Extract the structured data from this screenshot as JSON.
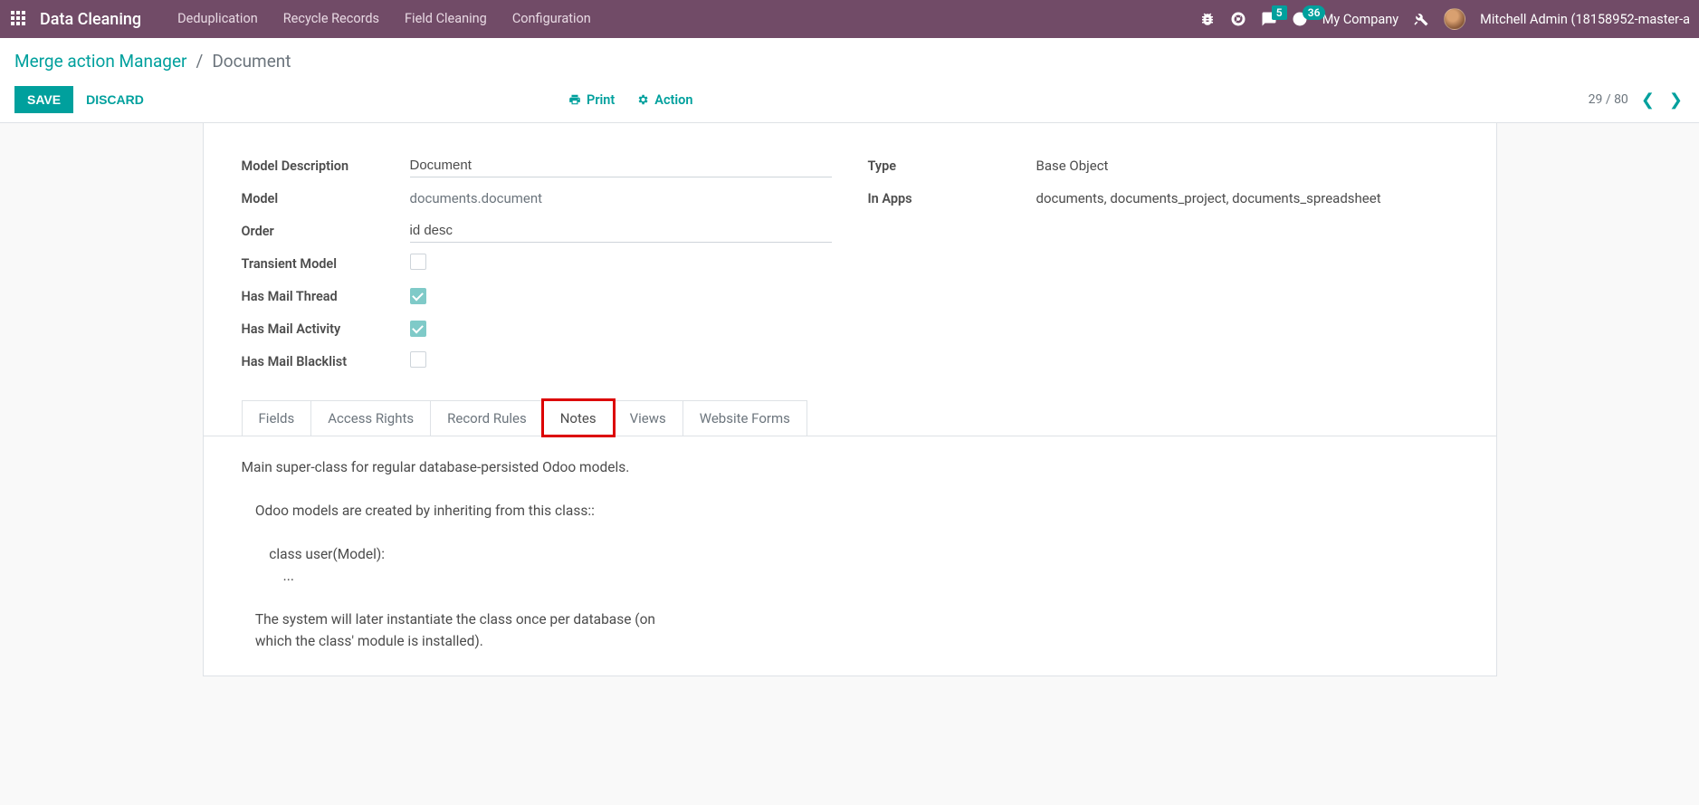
{
  "navbar": {
    "brand": "Data Cleaning",
    "menu": [
      "Deduplication",
      "Recycle Records",
      "Field Cleaning",
      "Configuration"
    ],
    "messages_badge": "5",
    "activities_badge": "36",
    "company": "My Company",
    "user": "Mitchell Admin (18158952-master-a"
  },
  "breadcrumb": {
    "parent": "Merge action Manager",
    "current": "Document"
  },
  "actions": {
    "save": "SAVE",
    "discard": "DISCARD",
    "print": "Print",
    "action": "Action"
  },
  "pager": {
    "text": "29 / 80"
  },
  "form": {
    "left": {
      "model_description_label": "Model Description",
      "model_description_value": "Document",
      "model_label": "Model",
      "model_value": "documents.document",
      "order_label": "Order",
      "order_value": "id desc",
      "transient_label": "Transient Model",
      "mail_thread_label": "Has Mail Thread",
      "mail_activity_label": "Has Mail Activity",
      "mail_blacklist_label": "Has Mail Blacklist"
    },
    "right": {
      "type_label": "Type",
      "type_value": "Base Object",
      "in_apps_label": "In Apps",
      "in_apps_value": "documents, documents_project, documents_spreadsheet"
    }
  },
  "tabs": {
    "items": [
      "Fields",
      "Access Rights",
      "Record Rules",
      "Notes",
      "Views",
      "Website Forms"
    ],
    "active": "Notes"
  },
  "notes_content": "Main super-class for regular database-persisted Odoo models.\n\n    Odoo models are created by inheriting from this class::\n\n        class user(Model):\n            ...\n\n    The system will later instantiate the class once per database (on\n    which the class' module is installed)."
}
